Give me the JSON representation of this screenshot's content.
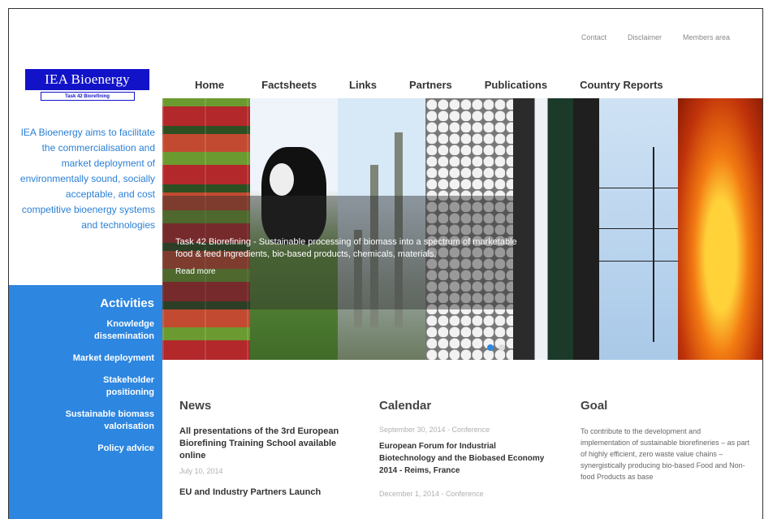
{
  "toplinks": [
    "Contact",
    "Disclaimer",
    "Members area"
  ],
  "logo": {
    "title": "IEA Bioenergy",
    "subtitle": "Task 42 Biorefining"
  },
  "tagline": "IEA Bioenergy aims to facilitate the commercialisation and market deployment of environmentally sound, socially acceptable, and cost competitive bioenergy systems and technologies",
  "nav": [
    "Home",
    "Factsheets",
    "Links",
    "Partners",
    "Publications",
    "Country Reports"
  ],
  "sidebar": {
    "title": "Activities",
    "items": [
      "Knowledge dissemination",
      "Market deployment",
      "Stakeholder positioning",
      "Sustainable biomass valorisation",
      "Policy advice"
    ]
  },
  "banner": {
    "text": "Task 42 Biorefining - Sustainable processing of biomass into a spectrum of marketable food & feed ingredients, bio-based products, chemicals, materials,",
    "more": "Read more"
  },
  "news": {
    "heading": "News",
    "items": [
      {
        "title": "All presentations of the 3rd European Biorefining Training School available online",
        "date": "July 10, 2014"
      },
      {
        "title": "EU and Industry Partners Launch",
        "date": ""
      }
    ]
  },
  "calendar": {
    "heading": "Calendar",
    "items": [
      {
        "meta": "September 30, 2014 - Conference",
        "title": "European Forum for Industrial Biotechnology and the Biobased Economy 2014 - Reims, France"
      },
      {
        "meta": "December 1, 2014 - Conference",
        "title": ""
      }
    ]
  },
  "goal": {
    "heading": "Goal",
    "text": "To contribute to the development and implementation of sustainable biorefineries – as part of highly efficient, zero waste value chains – synergistically producing bio-based Food and Non-food Products as base"
  },
  "colors": {
    "brand_blue": "#1212c8",
    "sidebar_blue": "#2d86e0",
    "tagline_blue": "#2a7fd6"
  }
}
